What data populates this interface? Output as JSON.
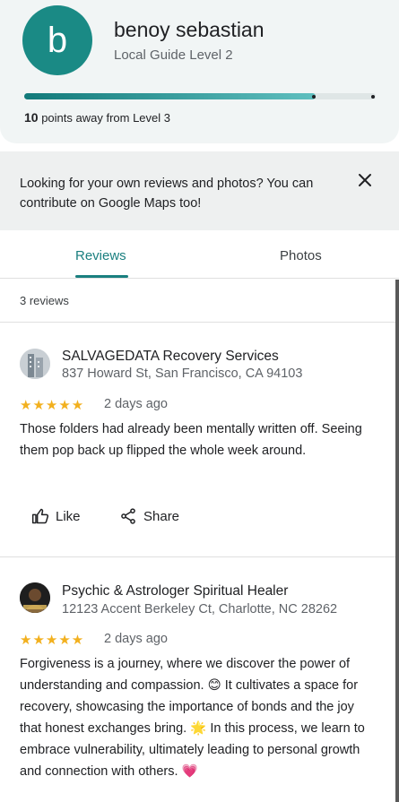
{
  "profile": {
    "avatar_letter": "b",
    "name": "benoy sebastian",
    "level_label": "Local Guide Level 2",
    "progress_fraction": 0.83,
    "points_bold": "10",
    "points_rest": " points away from Level 3",
    "accent_color": "#1a8a85"
  },
  "banner": {
    "text": "Looking for your own reviews and photos? You can contribute on Google Maps too!",
    "close_icon": "close-icon"
  },
  "tabs": [
    {
      "label": "Reviews",
      "active": true
    },
    {
      "label": "Photos",
      "active": false
    }
  ],
  "reviews_count": "3 reviews",
  "reviews": [
    {
      "place_name": "SALVAGEDATA Recovery Services",
      "address": "837 Howard St, San Francisco, CA 94103",
      "stars": "★★★★★",
      "rating": 5,
      "date": "2 days ago",
      "text": "Those folders had already been mentally written off. Seeing them pop back up flipped the whole week around.",
      "like_label": "Like",
      "share_label": "Share"
    },
    {
      "place_name": "Psychic & Astrologer Spiritual Healer",
      "address": "12123 Accent Berkeley Ct, Charlotte, NC 28262",
      "stars": "★★★★★",
      "rating": 5,
      "date": "2 days ago",
      "text": "Forgiveness is a journey, where we discover the power of understanding and compassion. 😊 It cultivates a space for recovery, showcasing the importance of bonds and the joy that honest exchanges bring. 🌟 In this process, we learn to embrace vulnerability, ultimately leading to personal growth and connection with others. 💗"
    }
  ]
}
